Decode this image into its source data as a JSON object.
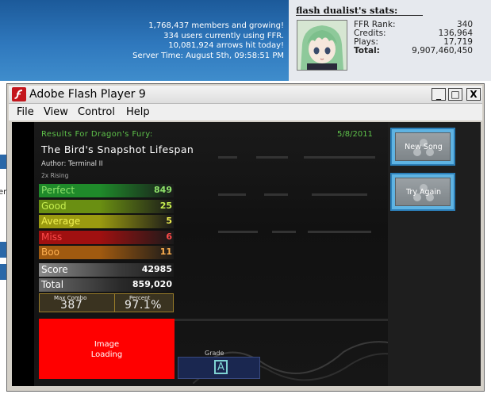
{
  "site": {
    "stats_lines": [
      "1,768,437 members and growing!",
      "334 users currently using FFR.",
      "10,081,924 arrows hit today!",
      "Server Time: August 5th, 09:58:51 PM"
    ],
    "profile": {
      "username": "flash dualist",
      "title_suffix": "'s stats:",
      "stats": [
        {
          "label": "FFR Rank:",
          "value": "340"
        },
        {
          "label": "Credits:",
          "value": "136,964"
        },
        {
          "label": "Plays:",
          "value": "17,719"
        },
        {
          "label": "Total:",
          "value": "9,907,460,450"
        }
      ]
    },
    "left_edge_text": "er"
  },
  "window": {
    "title": "Adobe Flash Player 9",
    "minimize": "_",
    "maximize": "□",
    "close": "X",
    "menu": [
      "File",
      "View",
      "Control",
      "Help"
    ]
  },
  "game": {
    "results_for": "Results For Dragon's Fury:",
    "date": "5/8/2011",
    "song_title": "The Bird's Snapshot Lifespan",
    "author": "Author: Terminal II",
    "difficulty": "2x Rising",
    "judgements": [
      {
        "label": "Perfect",
        "value": "849",
        "color": "#1f8a2a",
        "text": "#8fe26a"
      },
      {
        "label": "Good",
        "value": "25",
        "color": "#6a8f12",
        "text": "#c8f050"
      },
      {
        "label": "Average",
        "value": "5",
        "color": "#9a9a10",
        "text": "#f0f050"
      },
      {
        "label": "Miss",
        "value": "6",
        "color": "#a01010",
        "text": "#ff4a4a"
      },
      {
        "label": "Boo",
        "value": "11",
        "color": "#a05a10",
        "text": "#ffb050"
      }
    ],
    "score_label": "Score",
    "score_value": "42985",
    "total_label": "Total",
    "total_value": "859,020",
    "max_combo_label": "Max Combo",
    "max_combo_value": "387",
    "percent_label": "Percent",
    "percent_value": "97.1%",
    "image_loading": [
      "Image",
      "Loading"
    ],
    "grade_label": "Grade",
    "grade_value": "A",
    "buttons": {
      "new_song": "New Song",
      "try_again": "Try Again"
    }
  }
}
